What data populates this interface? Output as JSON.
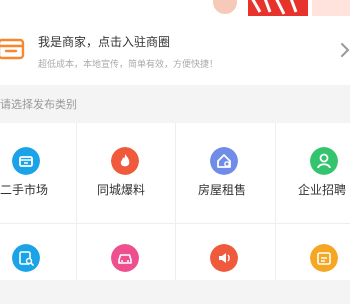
{
  "merchant": {
    "title": "我是商家，点击入驻商圈",
    "subtitle": "超低成本，本地宣传，简单有效，方便快捷！",
    "icon": "shop-icon"
  },
  "category_prompt": "请选择发布类别",
  "categories": [
    {
      "label": "二手市场",
      "icon": "box-icon",
      "color": "#1aa3e8"
    },
    {
      "label": "同城爆料",
      "icon": "flame-icon",
      "color": "#f05a3c"
    },
    {
      "label": "房屋租售",
      "icon": "house-icon",
      "color": "#6f8ce8"
    },
    {
      "label": "企业招聘",
      "icon": "person-icon",
      "color": "#34c46d"
    },
    {
      "label": "",
      "icon": "search-doc-icon",
      "color": "#1aa3e8"
    },
    {
      "label": "",
      "icon": "car-icon",
      "color": "#ee4f8e"
    },
    {
      "label": "",
      "icon": "speaker-icon",
      "color": "#f05a3c"
    },
    {
      "label": "",
      "icon": "card-icon",
      "color": "#f5a623"
    }
  ],
  "colors": {
    "brand": "#f05a3c",
    "banner_red": "#e8322c"
  }
}
